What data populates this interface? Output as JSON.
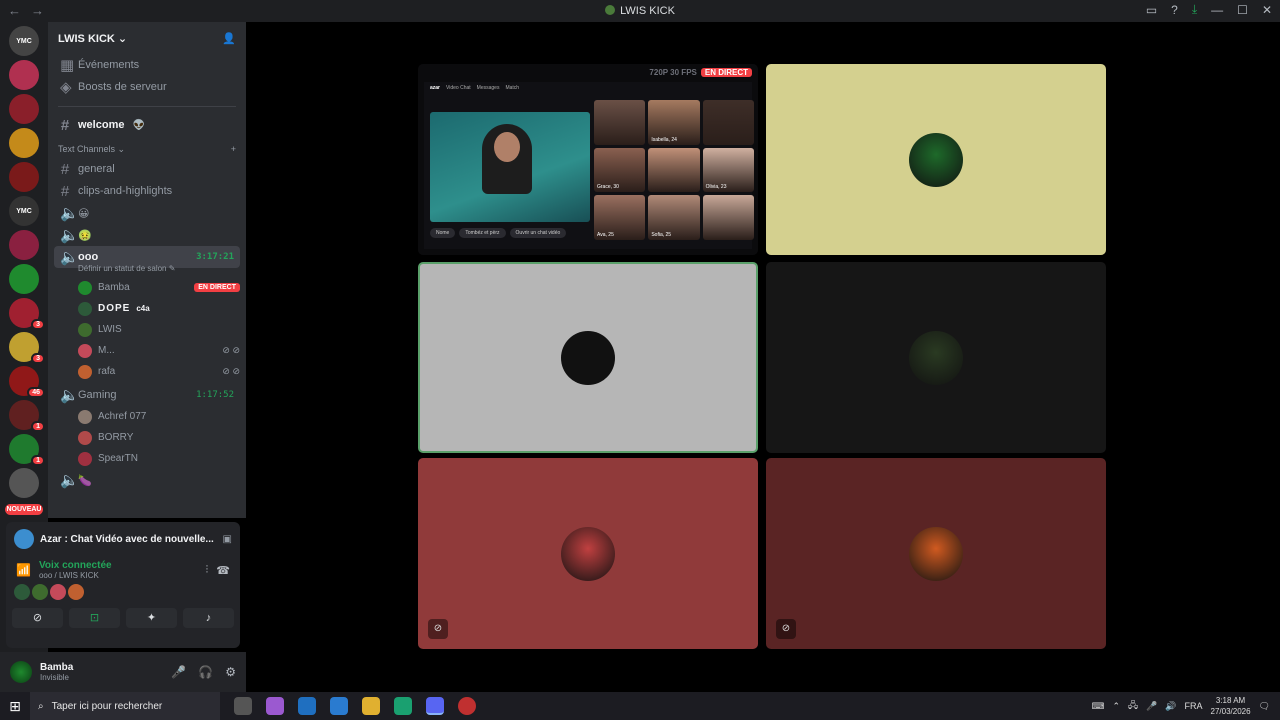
{
  "window": {
    "title": "LWIS KICK",
    "back": "←",
    "forward": "→"
  },
  "server": {
    "name": "LWIS KICK"
  },
  "channels": {
    "events": "Événements",
    "boosts": "Boosts de serveur",
    "welcome": "welcome",
    "category": "Text Channels",
    "general": "general",
    "clips": "clips-and-highlights",
    "voice1": "😀",
    "voice2": "🤢",
    "active_voice": {
      "name": "ooo",
      "timer": "3:17:21",
      "status": "Définir un statut de salon"
    },
    "members": [
      {
        "name": "Bamba",
        "live": "EN DIRECT",
        "color": "#1f8a2e"
      },
      {
        "name": "DOPE",
        "tag": "c4a",
        "color": "#2d5a3a"
      },
      {
        "name": "LWIS",
        "color": "#3e6b2e"
      },
      {
        "name": "M...",
        "color": "#c44a5a"
      },
      {
        "name": "rafa",
        "color": "#c06030"
      }
    ],
    "gaming": {
      "name": "Gaming",
      "timer": "1:17:52"
    },
    "gaming_members": [
      {
        "name": "Achref 077",
        "color": "#8a7a70"
      },
      {
        "name": "BORRY",
        "color": "#b04a4a"
      },
      {
        "name": "SpearTN",
        "color": "#a03040"
      }
    ],
    "voice3": "🍆"
  },
  "servers": [
    {
      "label": "YMC",
      "bg": "#444",
      "badge": ""
    },
    {
      "label": "",
      "bg": "#b03050",
      "badge": ""
    },
    {
      "label": "",
      "bg": "#8a1f2a",
      "badge": ""
    },
    {
      "label": "",
      "bg": "#c48a1a",
      "badge": ""
    },
    {
      "label": "",
      "bg": "#7a1a1a",
      "badge": ""
    },
    {
      "label": "YMC",
      "bg": "#333",
      "badge": ""
    },
    {
      "label": "",
      "bg": "#8a2040",
      "badge": ""
    },
    {
      "label": "",
      "bg": "#1f8a2e",
      "badge": ""
    },
    {
      "label": "",
      "bg": "#a02030",
      "badge": "3"
    },
    {
      "label": "",
      "bg": "#c0a030",
      "badge": "3"
    },
    {
      "label": "",
      "bg": "#901818",
      "badge": "46"
    },
    {
      "label": "",
      "bg": "#602020",
      "badge": "1"
    },
    {
      "label": "",
      "bg": "#1f7a2e",
      "badge": "1"
    },
    {
      "label": "",
      "bg": "#555",
      "badge": ""
    }
  ],
  "nouveau": "NOUVEAU",
  "activity": {
    "title": "Azar : Chat Vidéo avec de nouvelle..."
  },
  "voice_panel": {
    "connected": "Voix connectée",
    "location": "ooo / LWIS KICK"
  },
  "user": {
    "name": "Bamba",
    "status": "Invisible"
  },
  "stream": {
    "quality": "720P 30 FPS",
    "live": "EN DIRECT",
    "app_tabs": [
      "Video Chat",
      "Messages",
      "Match"
    ],
    "grid": [
      {
        "name": "",
        "bg": "#6a5046"
      },
      {
        "name": "Isabella, 24",
        "bg": "#a57a60"
      },
      {
        "name": "",
        "bg": "#3e2e28"
      },
      {
        "name": "Grace, 30",
        "bg": "#8a6050"
      },
      {
        "name": "",
        "bg": "#c09078"
      },
      {
        "name": "Olivia, 23",
        "bg": "#d0b0a0"
      },
      {
        "name": "Ava, 25",
        "bg": "#9a7060"
      },
      {
        "name": "Sofia, 25",
        "bg": "#b08a78"
      },
      {
        "name": "",
        "bg": "#c8a898"
      }
    ],
    "buttons": [
      "Nome",
      "Tombéz et pèrz",
      "Ouvrir un chat vidéo"
    ]
  },
  "tiles": [
    {
      "bg": "#d4d08f",
      "pfp": "#1e6a2a"
    },
    {
      "bg": "#b6b6b6",
      "pfp": "#111"
    },
    {
      "bg": "#161616",
      "pfp": "#2a3a22"
    },
    {
      "bg": "#903a3a",
      "pfp": "#c04040"
    },
    {
      "bg": "#5a2424",
      "pfp": "#d05a20"
    }
  ],
  "taskbar": {
    "search": "Taper ici pour rechercher",
    "lang": "FRA",
    "time": "3:18 AM",
    "date": "27/03/2026"
  }
}
